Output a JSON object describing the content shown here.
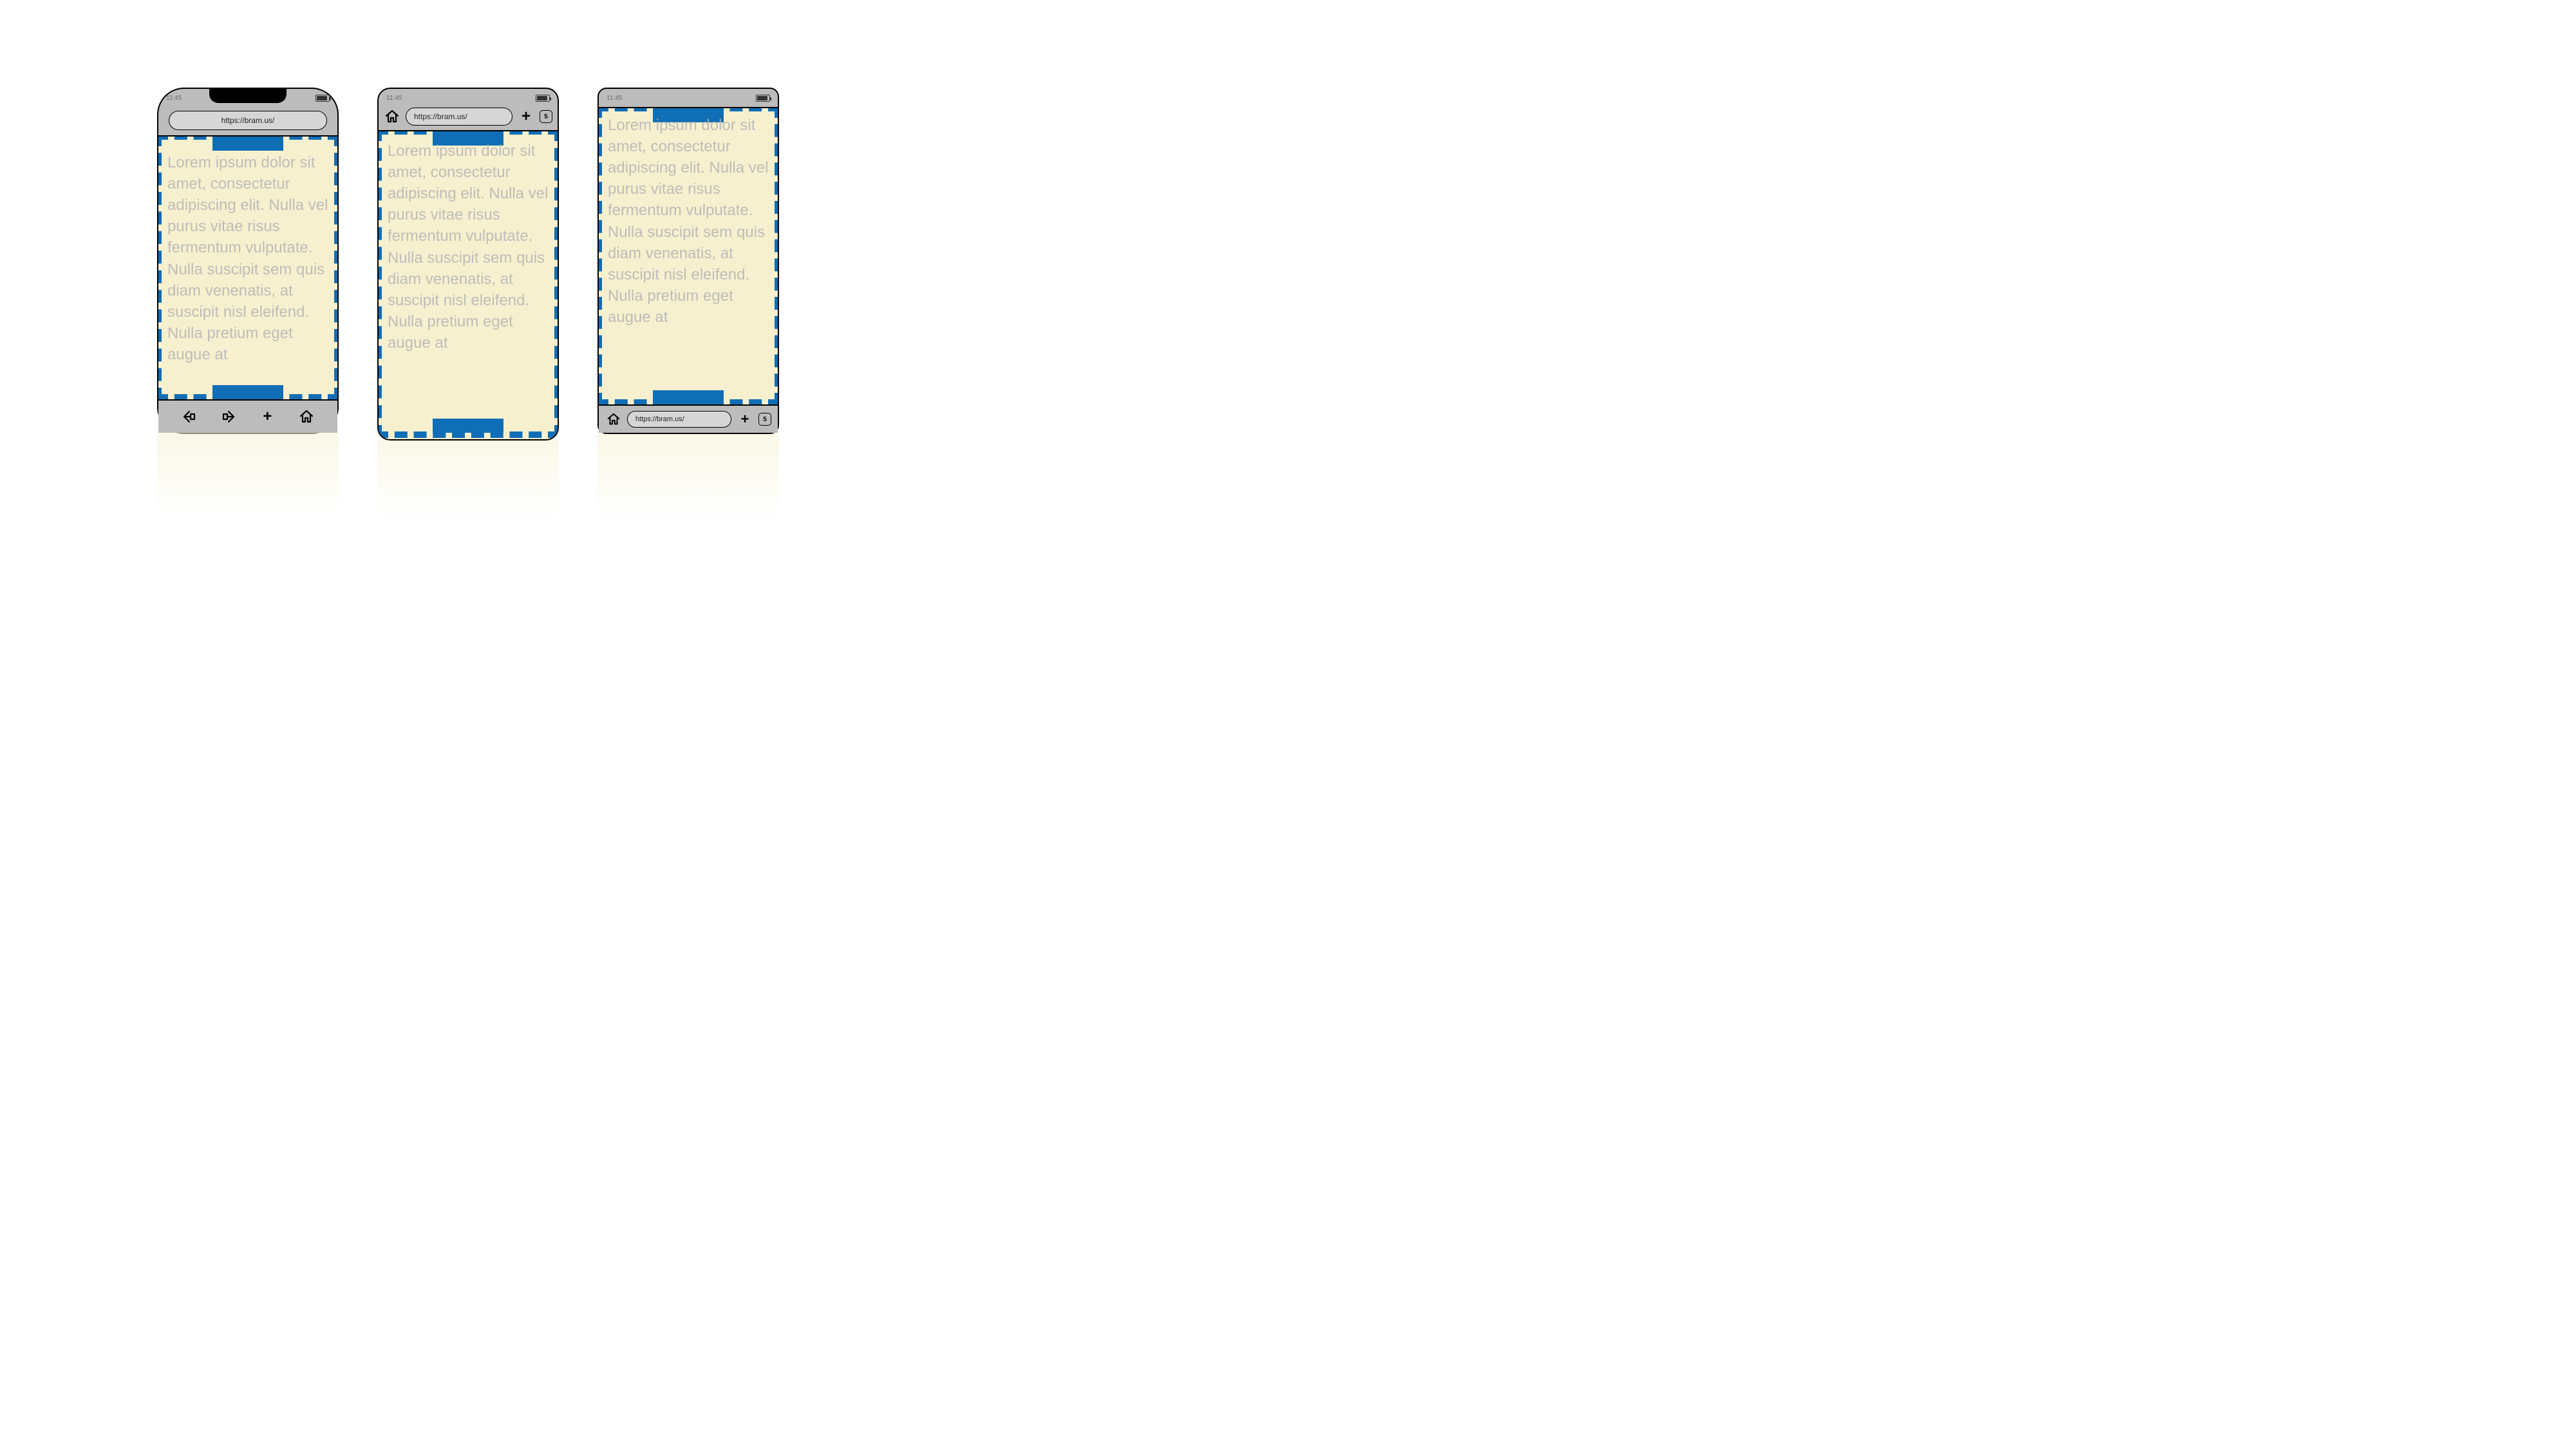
{
  "status_time": "11:45",
  "url": "https://bram.us/",
  "tab_count": "5",
  "lorem": "Lorem ipsum dolor sit amet, consectetur adipiscing elit. Nulla vel purus vitae risus fermentum vulputate. Nulla suscipit sem quis diam venenatis, at suscipit nisl eleifend. Nulla pretium eget augue at"
}
